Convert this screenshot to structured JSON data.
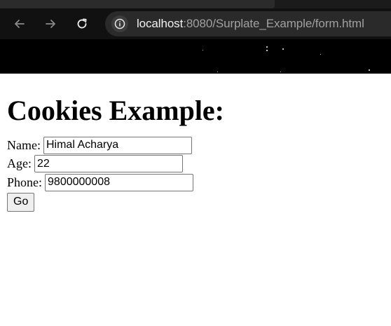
{
  "browser": {
    "url_host": "localhost",
    "url_rest": ":8080/Surplate_Example/form.html"
  },
  "page": {
    "heading": "Cookies Example:"
  },
  "form": {
    "name_label": "Name:",
    "name_value": "Himal Acharya",
    "age_label": "Age:",
    "age_value": "22",
    "phone_label": "Phone:",
    "phone_value": "9800000008",
    "submit_label": "Go"
  }
}
